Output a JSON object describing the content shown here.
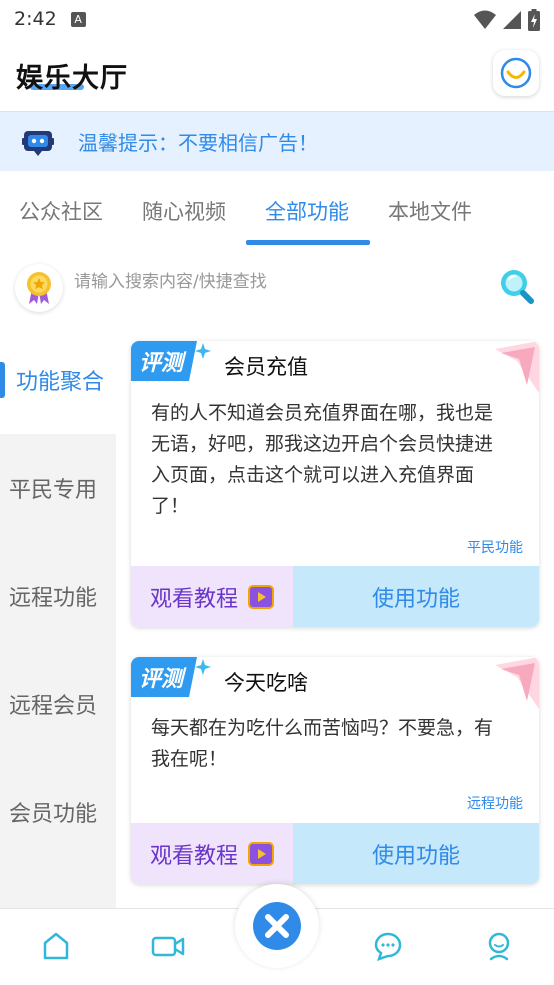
{
  "status_bar": {
    "time": "2:42",
    "notification_letter": "A"
  },
  "header": {
    "title": "娱乐大厅"
  },
  "tip": {
    "text": "温馨提示：不要相信广告！"
  },
  "tabs": [
    {
      "label": "公众社区",
      "active": false
    },
    {
      "label": "随心视频",
      "active": false
    },
    {
      "label": "全部功能",
      "active": true
    },
    {
      "label": "本地文件",
      "active": false
    }
  ],
  "search": {
    "placeholder": "请输入搜索内容/快捷查找"
  },
  "sidebar": {
    "items": [
      {
        "label": "功能聚合",
        "active": true
      },
      {
        "label": "平民专用",
        "active": false
      },
      {
        "label": "远程功能",
        "active": false
      },
      {
        "label": "远程会员",
        "active": false
      },
      {
        "label": "会员功能",
        "active": false
      }
    ]
  },
  "cards": [
    {
      "badge": "评测",
      "title": "会员充值",
      "desc_lines": [
        "有的人不知道会员充值界面在哪，我也是",
        "无语，好吧，那我这边开启个会员快捷进",
        "入页面，点击这个就可以进入充值界面",
        "了！"
      ],
      "tag": "平民功能",
      "watch_label": "观看教程",
      "use_label": "使用功能"
    },
    {
      "badge": "评测",
      "title": "今天吃啥",
      "desc_lines": [
        "每天都在为吃什么而苦恼吗？不要急，有",
        "我在呢！"
      ],
      "tag": "远程功能",
      "watch_label": "观看教程",
      "use_label": "使用功能"
    }
  ],
  "icons": {
    "tip": "robot-icon",
    "avatar": "smile-icon",
    "medal": "medal-icon",
    "search": "search-icon",
    "nav": [
      "home-icon",
      "video-icon",
      "chat-icon",
      "profile-icon"
    ],
    "fab": "close-icon"
  },
  "colors": {
    "accent": "#2f8ae8",
    "tip_background": "#e6f1ff",
    "watch_background": "#efe4fb",
    "watch_text": "#6a35c9",
    "use_background": "#c5e8fb",
    "nav_icon": "#30b8d8"
  }
}
